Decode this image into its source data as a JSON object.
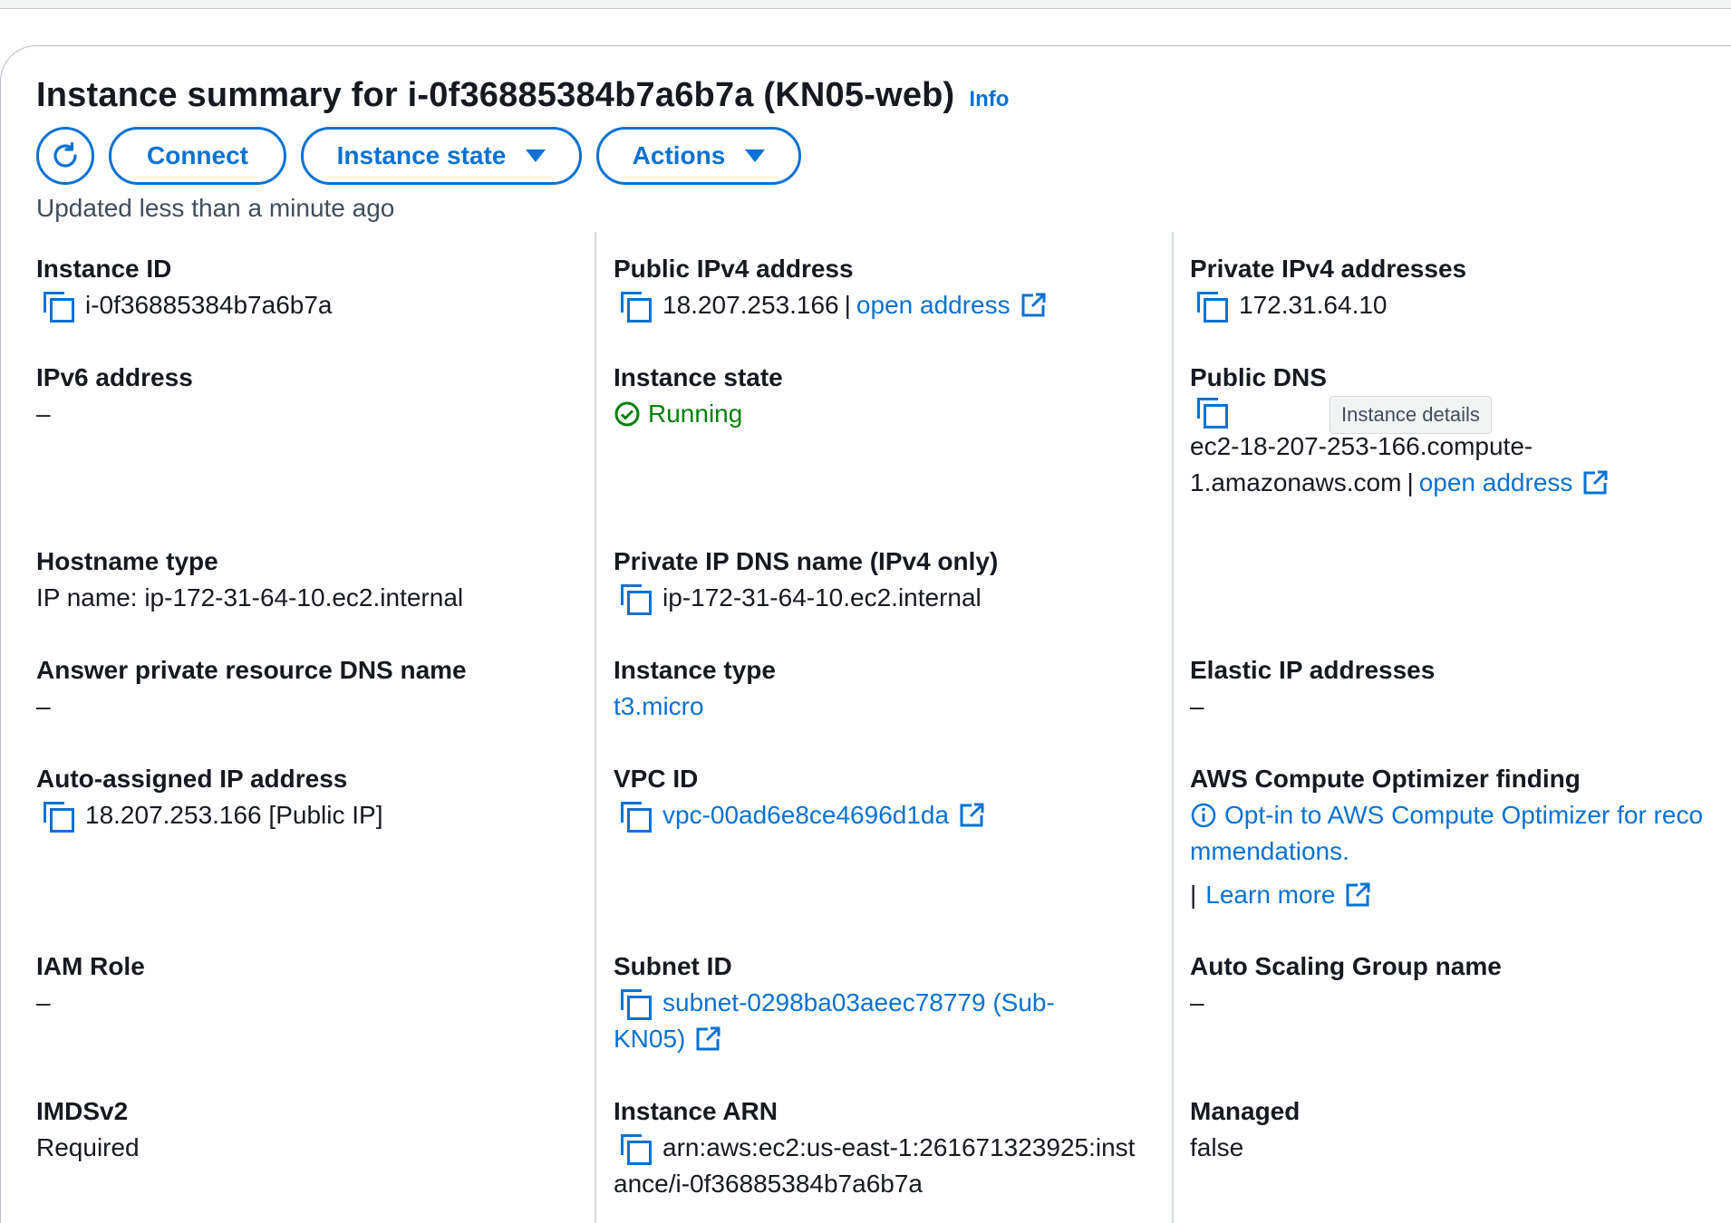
{
  "header": {
    "title": "Instance summary for i-0f36885384b7a6b7a (KN05-web)",
    "info_label": "Info",
    "updated": "Updated less than a minute ago"
  },
  "toolbar": {
    "connect": "Connect",
    "instance_state": "Instance state",
    "actions": "Actions"
  },
  "tooltip": "Instance details",
  "fields": {
    "instance_id": {
      "label": "Instance ID",
      "value": "i-0f36885384b7a6b7a"
    },
    "public_ipv4": {
      "label": "Public IPv4 address",
      "value": "18.207.253.166",
      "sep": "|",
      "link": "open address"
    },
    "private_ipv4": {
      "label": "Private IPv4 addresses",
      "value": "172.31.64.10"
    },
    "ipv6": {
      "label": "IPv6 address",
      "value": "–"
    },
    "instance_state": {
      "label": "Instance state",
      "value": "Running"
    },
    "public_dns": {
      "label": "Public DNS",
      "value_line1": "ec2-18-207-253-166.compute-",
      "value_line2": "1.amazonaws.com",
      "sep": "|",
      "link": "open address"
    },
    "hostname_type": {
      "label": "Hostname type",
      "value": "IP name: ip-172-31-64-10.ec2.internal"
    },
    "private_ip_dns": {
      "label": "Private IP DNS name (IPv4 only)",
      "value": "ip-172-31-64-10.ec2.internal"
    },
    "answer_dns": {
      "label": "Answer private resource DNS name",
      "value": "–"
    },
    "instance_type": {
      "label": "Instance type",
      "value": "t3.micro"
    },
    "elastic_ip": {
      "label": "Elastic IP addresses",
      "value": "–"
    },
    "auto_ip": {
      "label": "Auto-assigned IP address",
      "value": "18.207.253.166 [Public IP]"
    },
    "vpc_id": {
      "label": "VPC ID",
      "value": "vpc-00ad6e8ce4696d1da"
    },
    "optimizer": {
      "label": "AWS Compute Optimizer finding",
      "link_line1": "Opt-in to AWS Compute Optimizer for reco",
      "link_line2": "mmendations.",
      "sep": "|",
      "learn_more": "Learn more"
    },
    "iam_role": {
      "label": "IAM Role",
      "value": "–"
    },
    "subnet_id": {
      "label": "Subnet ID",
      "value_line1": "subnet-0298ba03aeec78779 (Sub-",
      "value_line2": "KN05)"
    },
    "asg_name": {
      "label": "Auto Scaling Group name",
      "value": "–"
    },
    "imdsv2": {
      "label": "IMDSv2",
      "value": "Required"
    },
    "instance_arn": {
      "label": "Instance ARN",
      "value_line1": "arn:aws:ec2:us-east-1:261671323925:inst",
      "value_line2": "ance/i-0f36885384b7a6b7a"
    },
    "managed": {
      "label": "Managed",
      "value": "false"
    }
  },
  "colors": {
    "link": "#0972d3",
    "success": "#037f0c",
    "text": "#16191f"
  }
}
